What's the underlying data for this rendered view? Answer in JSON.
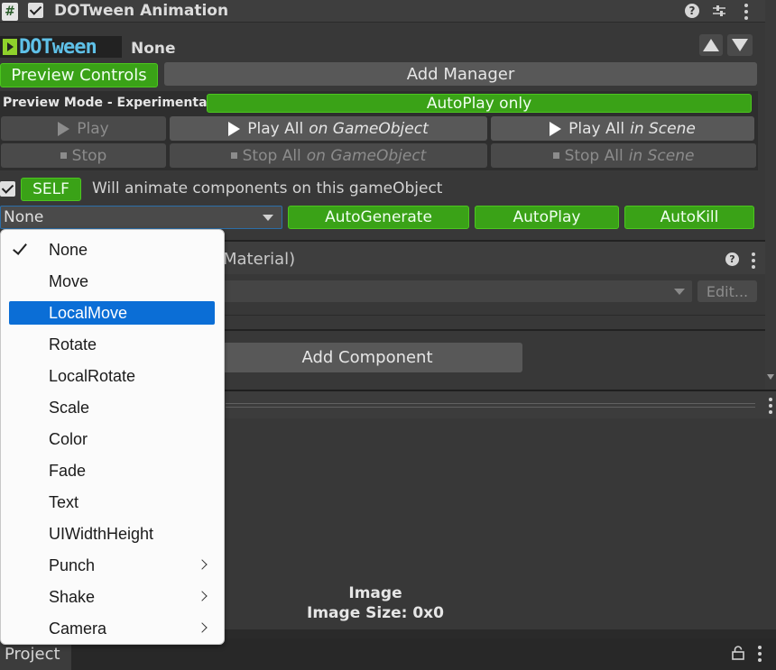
{
  "header": {
    "title": "DOTween Animation"
  },
  "dotween": {
    "logo": "DOTween",
    "status": "None"
  },
  "buttons": {
    "preview_controls": "Preview Controls",
    "add_manager": "Add Manager",
    "preview_mode": "Preview Mode - Experimental",
    "autoplay_only": "AutoPlay only",
    "play": "Play",
    "play_all": "Play All",
    "on_gameobject": "on GameObject",
    "in_scene": "in Scene",
    "stop": "Stop",
    "stop_all": "Stop All",
    "self": "SELF",
    "self_desc": "Will animate components on this gameObject",
    "anim_type": "None",
    "autogenerate": "AutoGenerate",
    "autoplay": "AutoPlay",
    "autokill": "AutoKill",
    "edit": "Edit...",
    "add_component": "Add Component"
  },
  "material": {
    "label": "Material)"
  },
  "preview": {
    "title": "Image",
    "size": "Image Size: 0x0"
  },
  "project": {
    "tab": "Project"
  },
  "dropdown": {
    "items": [
      {
        "label": "None",
        "checked": true
      },
      {
        "label": "Move"
      },
      {
        "label": "LocalMove",
        "selected": true
      },
      {
        "label": "Rotate"
      },
      {
        "label": "LocalRotate"
      },
      {
        "label": "Scale"
      },
      {
        "label": "Color"
      },
      {
        "label": "Fade"
      },
      {
        "label": "Text"
      },
      {
        "label": "UIWidthHeight"
      },
      {
        "label": "Punch",
        "submenu": true
      },
      {
        "label": "Shake",
        "submenu": true
      },
      {
        "label": "Camera",
        "submenu": true
      }
    ]
  },
  "colors": {
    "accent_green": "#3aa217",
    "selection_blue": "#0b6ed6",
    "bg": "#383838"
  }
}
